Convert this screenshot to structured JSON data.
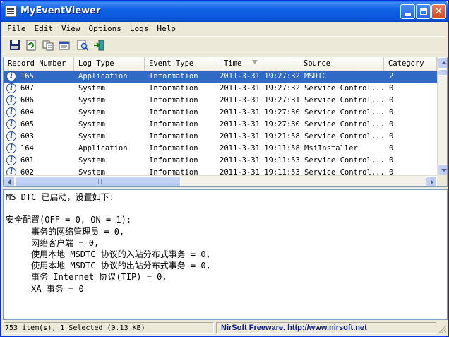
{
  "window": {
    "title": "MyEventViewer",
    "minimize_icon": "minimize-icon",
    "maximize_icon": "maximize-icon",
    "close_label": "✕"
  },
  "menu": [
    "File",
    "Edit",
    "View",
    "Options",
    "Logs",
    "Help"
  ],
  "toolbar": [
    "save-icon",
    "refresh-icon",
    "copy-icon",
    "properties-icon",
    "find-icon",
    "exit-icon"
  ],
  "columns": [
    "Record Number",
    "Log Type",
    "Event Type",
    "Time",
    "Source",
    "Category"
  ],
  "rows": [
    {
      "record": "165",
      "log_type": "Application",
      "event_type": "Information",
      "time": "2011-3-31 19:27:32",
      "source": "MSDTC",
      "category": "2",
      "selected": true
    },
    {
      "record": "607",
      "log_type": "System",
      "event_type": "Information",
      "time": "2011-3-31 19:27:32",
      "source": "Service Control...",
      "category": "0"
    },
    {
      "record": "606",
      "log_type": "System",
      "event_type": "Information",
      "time": "2011-3-31 19:27:31",
      "source": "Service Control...",
      "category": "0"
    },
    {
      "record": "604",
      "log_type": "System",
      "event_type": "Information",
      "time": "2011-3-31 19:27:30",
      "source": "Service Control...",
      "category": "0"
    },
    {
      "record": "605",
      "log_type": "System",
      "event_type": "Information",
      "time": "2011-3-31 19:27:30",
      "source": "Service Control...",
      "category": "0"
    },
    {
      "record": "603",
      "log_type": "System",
      "event_type": "Information",
      "time": "2011-3-31 19:21:58",
      "source": "Service Control...",
      "category": "0"
    },
    {
      "record": "164",
      "log_type": "Application",
      "event_type": "Information",
      "time": "2011-3-31 19:11:58",
      "source": "MsiInstaller",
      "category": "0"
    },
    {
      "record": "601",
      "log_type": "System",
      "event_type": "Information",
      "time": "2011-3-31 19:11:53",
      "source": "Service Control...",
      "category": "0"
    },
    {
      "record": "602",
      "log_type": "System",
      "event_type": "Information",
      "time": "2011-3-31 19:11:53",
      "source": "Service Control...",
      "category": "0"
    }
  ],
  "details": {
    "text": "MS DTC 已启动，设置如下:\n\n安全配置(OFF = 0, ON = 1):\n     事务的网络管理员 = 0,\n     网络客户端 = 0,\n     使用本地 MSDTC 协议的入站分布式事务 = 0,\n     使用本地 MSDTC 协议的出站分布式事务 = 0,\n     事务 Internet 协议(TIP) = 0,\n     XA 事务 = 0"
  },
  "status": {
    "items": "753 item(s), 1 Selected  (0.13 KB)",
    "credit": "NirSoft Freeware.  http://www.nirsoft.net"
  }
}
